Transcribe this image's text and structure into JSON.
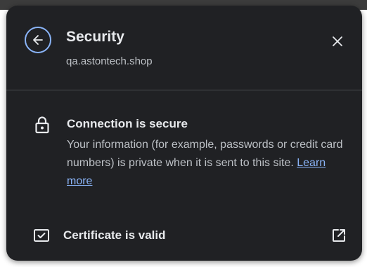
{
  "header": {
    "title": "Security",
    "origin": "qa.astontech.shop"
  },
  "connection": {
    "heading": "Connection is secure",
    "description": "Your information (for example, passwords or credit card numbers) is private when it is sent to this site. ",
    "learn_more": "Learn more"
  },
  "certificate": {
    "label": "Certificate is valid"
  },
  "icons": {
    "back": "arrow-left-icon",
    "close": "close-icon",
    "lock": "lock-icon",
    "certificate": "certificate-icon",
    "external": "open-in-new-icon"
  },
  "colors": {
    "background": "#202124",
    "accent": "#8ab4f8",
    "text_primary": "#e8eaed",
    "text_secondary": "#bdc1c6"
  }
}
